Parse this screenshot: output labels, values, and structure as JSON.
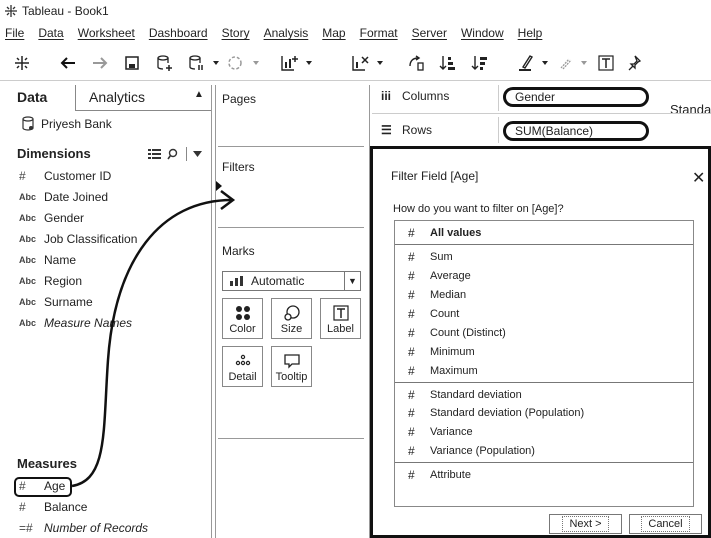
{
  "window": {
    "title": "Tableau - Book1"
  },
  "menu": [
    "File",
    "Data",
    "Worksheet",
    "Dashboard",
    "Story",
    "Analysis",
    "Map",
    "Format",
    "Server",
    "Window",
    "Help"
  ],
  "toolbar": {
    "fit_label": "Standa"
  },
  "left_pane": {
    "tabs": {
      "data": "Data",
      "analytics": "Analytics"
    },
    "datasource": "Priyesh Bank",
    "dimensions_title": "Dimensions",
    "dimension_icon": "Abc",
    "dimensions": [
      {
        "icon": "#",
        "label": "Customer ID"
      },
      {
        "icon": "Abc",
        "label": "Date Joined"
      },
      {
        "icon": "Abc",
        "label": "Gender"
      },
      {
        "icon": "Abc",
        "label": "Job Classification"
      },
      {
        "icon": "Abc",
        "label": "Name"
      },
      {
        "icon": "Abc",
        "label": "Region"
      },
      {
        "icon": "Abc",
        "label": "Surname"
      },
      {
        "icon": "Abc",
        "label": "Measure Names"
      }
    ],
    "measures_title": "Measures",
    "measures": [
      {
        "icon": "#",
        "label": "Age"
      },
      {
        "icon": "#",
        "label": "Balance"
      },
      {
        "icon": "=#",
        "label": "Number of Records"
      }
    ]
  },
  "cards": {
    "pages": "Pages",
    "filters": "Filters",
    "marks": "Marks",
    "mark_type": "Automatic",
    "buttons": {
      "color": "Color",
      "size": "Size",
      "label": "Label",
      "detail": "Detail",
      "tooltip": "Tooltip"
    }
  },
  "shelves": {
    "columns_label": "Columns",
    "columns_pill": "Gender",
    "rows_label": "Rows",
    "rows_pill": "SUM(Balance)"
  },
  "dialog": {
    "title": "Filter Field [Age]",
    "question": "How do you want to filter on [Age]?",
    "options": [
      {
        "label": "All values",
        "bold": true
      },
      {
        "label": "Sum"
      },
      {
        "label": "Average"
      },
      {
        "label": "Median"
      },
      {
        "label": "Count"
      },
      {
        "label": "Count (Distinct)"
      },
      {
        "label": "Minimum"
      },
      {
        "label": "Maximum"
      },
      {
        "label": "Standard deviation"
      },
      {
        "label": "Standard deviation (Population)"
      },
      {
        "label": "Variance"
      },
      {
        "label": "Variance (Population)"
      },
      {
        "label": "Attribute"
      }
    ],
    "next_label": "Next >",
    "cancel_label": "Cancel"
  }
}
